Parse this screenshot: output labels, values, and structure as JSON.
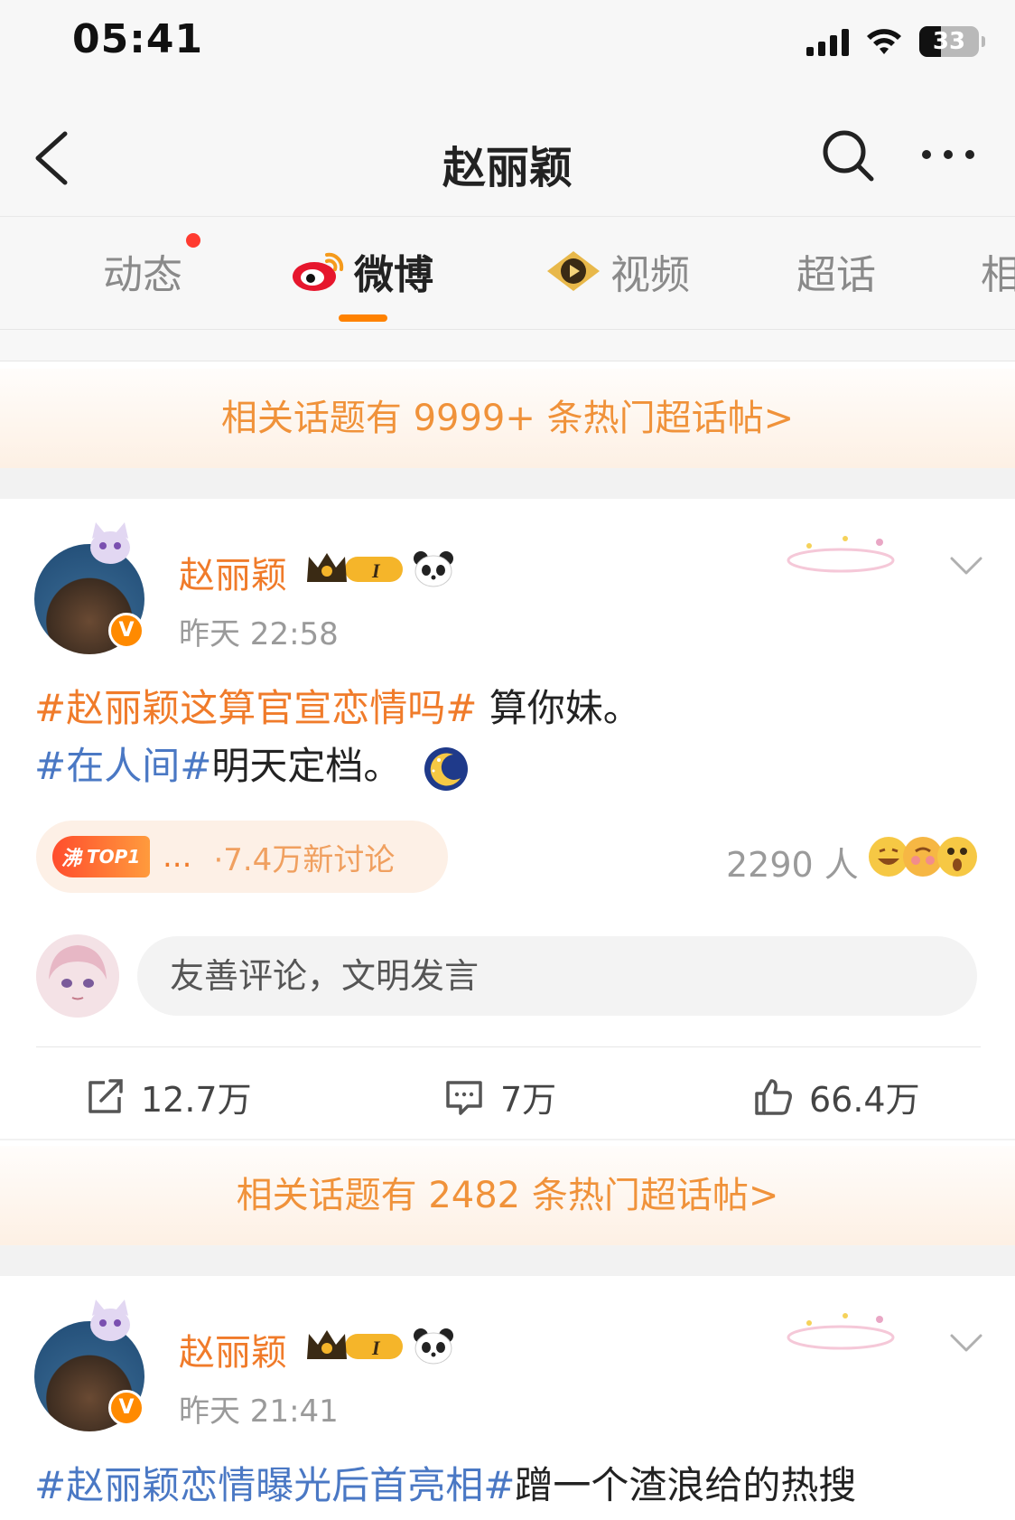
{
  "status_bar": {
    "time": "05:41",
    "battery": "33"
  },
  "nav": {
    "title": "赵丽颖"
  },
  "tabs": [
    {
      "label": "动态"
    },
    {
      "label": "微博"
    },
    {
      "label": "视频"
    },
    {
      "label": "超话"
    },
    {
      "label": "相"
    }
  ],
  "banners": [
    {
      "text": "相关话题有 9999+ 条热门超话帖>"
    },
    {
      "text": "相关话题有 2482 条热门超话帖>"
    }
  ],
  "posts": [
    {
      "username": "赵丽颖",
      "time": "昨天 22:58",
      "line1_tag": "#赵丽颖这算官宣恋情吗#",
      "line1_text": " 算你妹。",
      "line2_tag": "#在人间#",
      "line2_text": "明天定档。",
      "hot_badge": "TOP1",
      "hot_badge_glyph": "沸",
      "hot_dots": "...",
      "hot_text": "·7.4万新讨论",
      "people": "2290 人",
      "comment_placeholder": "友善评论，文明发言",
      "reposts": "12.7万",
      "comments": "7万",
      "likes": "66.4万"
    },
    {
      "username": "赵丽颖",
      "time": "昨天 21:41",
      "line1_tag": "#赵丽颖恋情曝光后首亮相#",
      "line1_text": "蹭一个渣浪给的热搜"
    }
  ],
  "colors": {
    "accent_orange": "#ff8200",
    "username_orange": "#f07b2a",
    "topic_blue": "#4a78c4",
    "banner_text": "#f0923a"
  },
  "icons": [
    "back-icon",
    "search-icon",
    "more-icon",
    "weibo-logo-icon",
    "video-icon",
    "crown-badge-icon",
    "panda-icon",
    "moon-emoji-icon",
    "chevron-down-icon",
    "repost-icon",
    "comment-icon",
    "like-icon"
  ]
}
